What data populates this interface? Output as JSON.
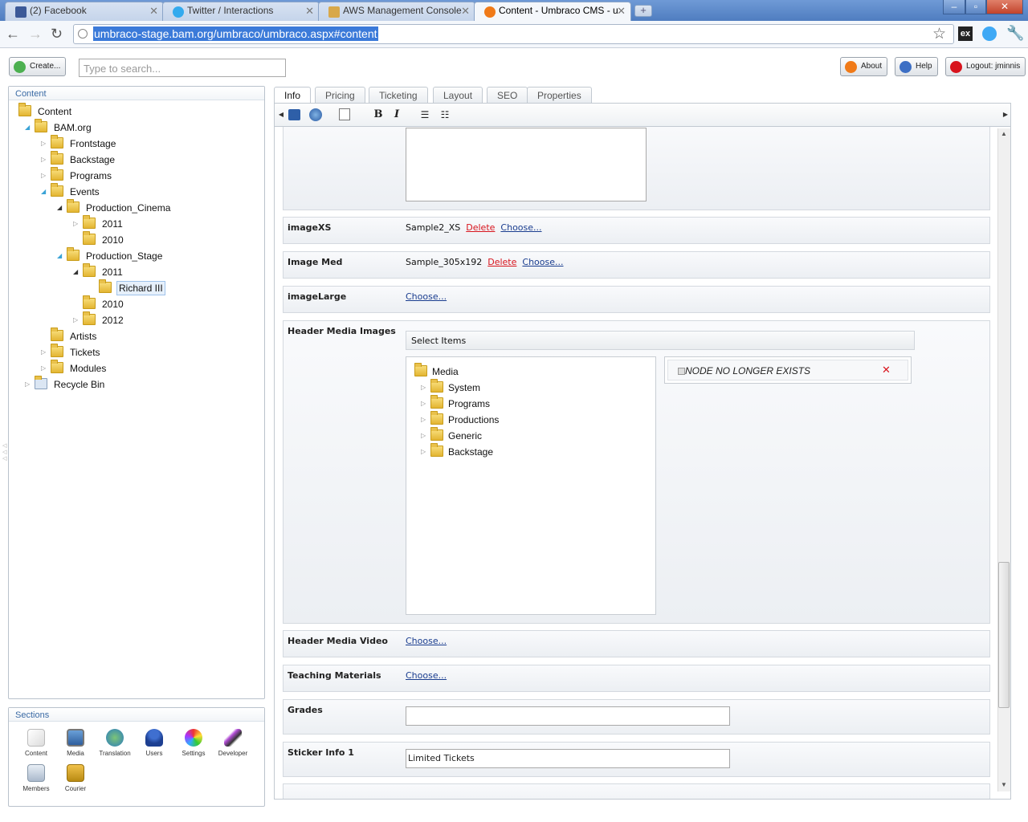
{
  "browser": {
    "tabs": [
      {
        "title": "(2) Facebook",
        "icon": "facebook-icon",
        "color": "#3b5998"
      },
      {
        "title": "Twitter / Interactions",
        "icon": "twitter-icon",
        "color": "#33aaee"
      },
      {
        "title": "AWS Management Console",
        "icon": "aws-box-icon",
        "color": "#d8a84a"
      },
      {
        "title": "Content - Umbraco CMS - u",
        "icon": "umbraco-icon",
        "color": "#f07a18"
      }
    ],
    "url": "umbraco-stage.bam.org/umbraco/umbraco.aspx#content"
  },
  "umbraco": {
    "create_label": "Create...",
    "search_placeholder": "Type to search...",
    "about_label": "About",
    "help_label": "Help",
    "logout_label": "Logout: jminnis"
  },
  "content_panel": {
    "title": "Content",
    "tree": [
      {
        "label": "Content",
        "arrow": ""
      },
      {
        "label": "BAM.org",
        "arrow": "open"
      },
      {
        "label": "Frontstage",
        "arrow": "closed"
      },
      {
        "label": "Backstage",
        "arrow": "closed"
      },
      {
        "label": "Programs",
        "arrow": "closed"
      },
      {
        "label": "Events",
        "arrow": "open"
      },
      {
        "label": "Production_Cinema",
        "arrow": "expanded"
      },
      {
        "label": "2011",
        "arrow": "closed"
      },
      {
        "label": "2010",
        "arrow": ""
      },
      {
        "label": "Production_Stage",
        "arrow": "open"
      },
      {
        "label": "2011",
        "arrow": "expanded"
      },
      {
        "label": "Richard III",
        "arrow": "",
        "selected": true
      },
      {
        "label": "2010",
        "arrow": ""
      },
      {
        "label": "2012",
        "arrow": "closed"
      },
      {
        "label": "Artists",
        "arrow": ""
      },
      {
        "label": "Tickets",
        "arrow": "closed"
      },
      {
        "label": "Modules",
        "arrow": "closed"
      },
      {
        "label": "Recycle Bin",
        "arrow": "closed"
      }
    ]
  },
  "sections_panel": {
    "title": "Sections",
    "items": [
      {
        "label": "Content",
        "icon": "content-pencil-icon"
      },
      {
        "label": "Media",
        "icon": "media-monitor-icon"
      },
      {
        "label": "Translation",
        "icon": "translation-globe-icon"
      },
      {
        "label": "Users",
        "icon": "users-person-icon"
      },
      {
        "label": "Settings",
        "icon": "settings-color-wheel-icon"
      },
      {
        "label": "Developer",
        "icon": "developer-wand-icon"
      },
      {
        "label": "Members",
        "icon": "members-card-icon"
      },
      {
        "label": "Courier",
        "icon": "courier-boxes-icon"
      }
    ]
  },
  "editor": {
    "tabs": [
      "Info",
      "Pricing",
      "Ticketing",
      "Layout",
      "SEO",
      "Properties"
    ],
    "toolbar": {
      "bold": "B",
      "italic": "I"
    },
    "props": {
      "imagexs": {
        "label": "imageXS",
        "value": "Sample2_XS",
        "delete": "Delete",
        "choose": "Choose..."
      },
      "imagemed": {
        "label": "Image Med",
        "value": "Sample_305x192",
        "delete": "Delete",
        "choose": "Choose..."
      },
      "imagelarge": {
        "label": "imageLarge",
        "choose": "Choose..."
      },
      "header_media_images": {
        "label": "Header Media Images",
        "select_items": "Select Items",
        "media_tree": [
          "Media",
          "System",
          "Programs",
          "Productions",
          "Generic",
          "Backstage"
        ],
        "selected_node": "NODE NO LONGER EXISTS"
      },
      "header_media_video": {
        "label": "Header Media Video",
        "choose": "Choose..."
      },
      "teaching_materials": {
        "label": "Teaching Materials",
        "choose": "Choose..."
      },
      "grades": {
        "label": "Grades",
        "value": ""
      },
      "sticker_info_1": {
        "label": "Sticker Info 1",
        "value": "Limited Tickets"
      }
    }
  }
}
